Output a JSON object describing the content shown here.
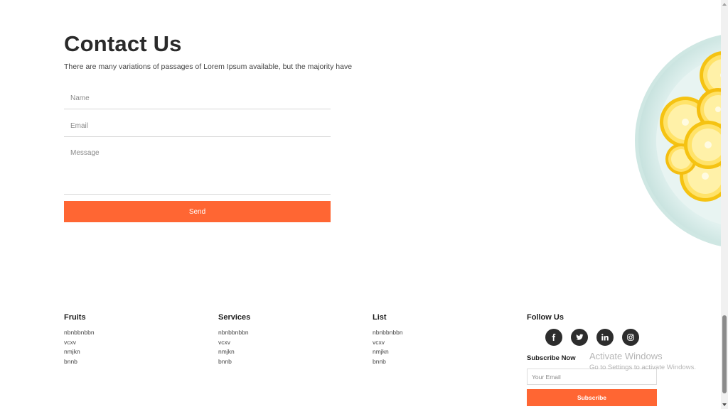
{
  "contact": {
    "title": "Contact Us",
    "description": "There are many variations of passages of Lorem Ipsum available, but the majority have",
    "name_placeholder": "Name",
    "email_placeholder": "Email",
    "message_placeholder": "Message",
    "send_label": "Send"
  },
  "footer": {
    "fruits": {
      "heading": "Fruits",
      "items": [
        "nbnbbnbbn",
        "vcxv",
        "nmjkn",
        "bnnb"
      ]
    },
    "services": {
      "heading": "Services",
      "items": [
        "nbnbbnbbn",
        "vcxv",
        "nmjkn",
        "bnnb"
      ]
    },
    "list": {
      "heading": "List",
      "items": [
        "nbnbbnbbn",
        "vcxv",
        "nmjkn",
        "bnnb"
      ]
    },
    "follow": {
      "heading": "Follow Us",
      "social_icons": [
        "facebook-icon",
        "twitter-icon",
        "linkedin-icon",
        "instagram-icon"
      ],
      "subscribe_heading": "Subscribe Now",
      "email_placeholder": "Your Email",
      "subscribe_label": "Subscribe"
    }
  },
  "watermark": {
    "title": "Activate Windows",
    "subtitle": "Go to Settings to activate Windows."
  },
  "colors": {
    "accent": "#ff6633",
    "social_bg": "#2d2d2d",
    "lemon": "#f7c81e",
    "plate": "#dff0ee"
  }
}
